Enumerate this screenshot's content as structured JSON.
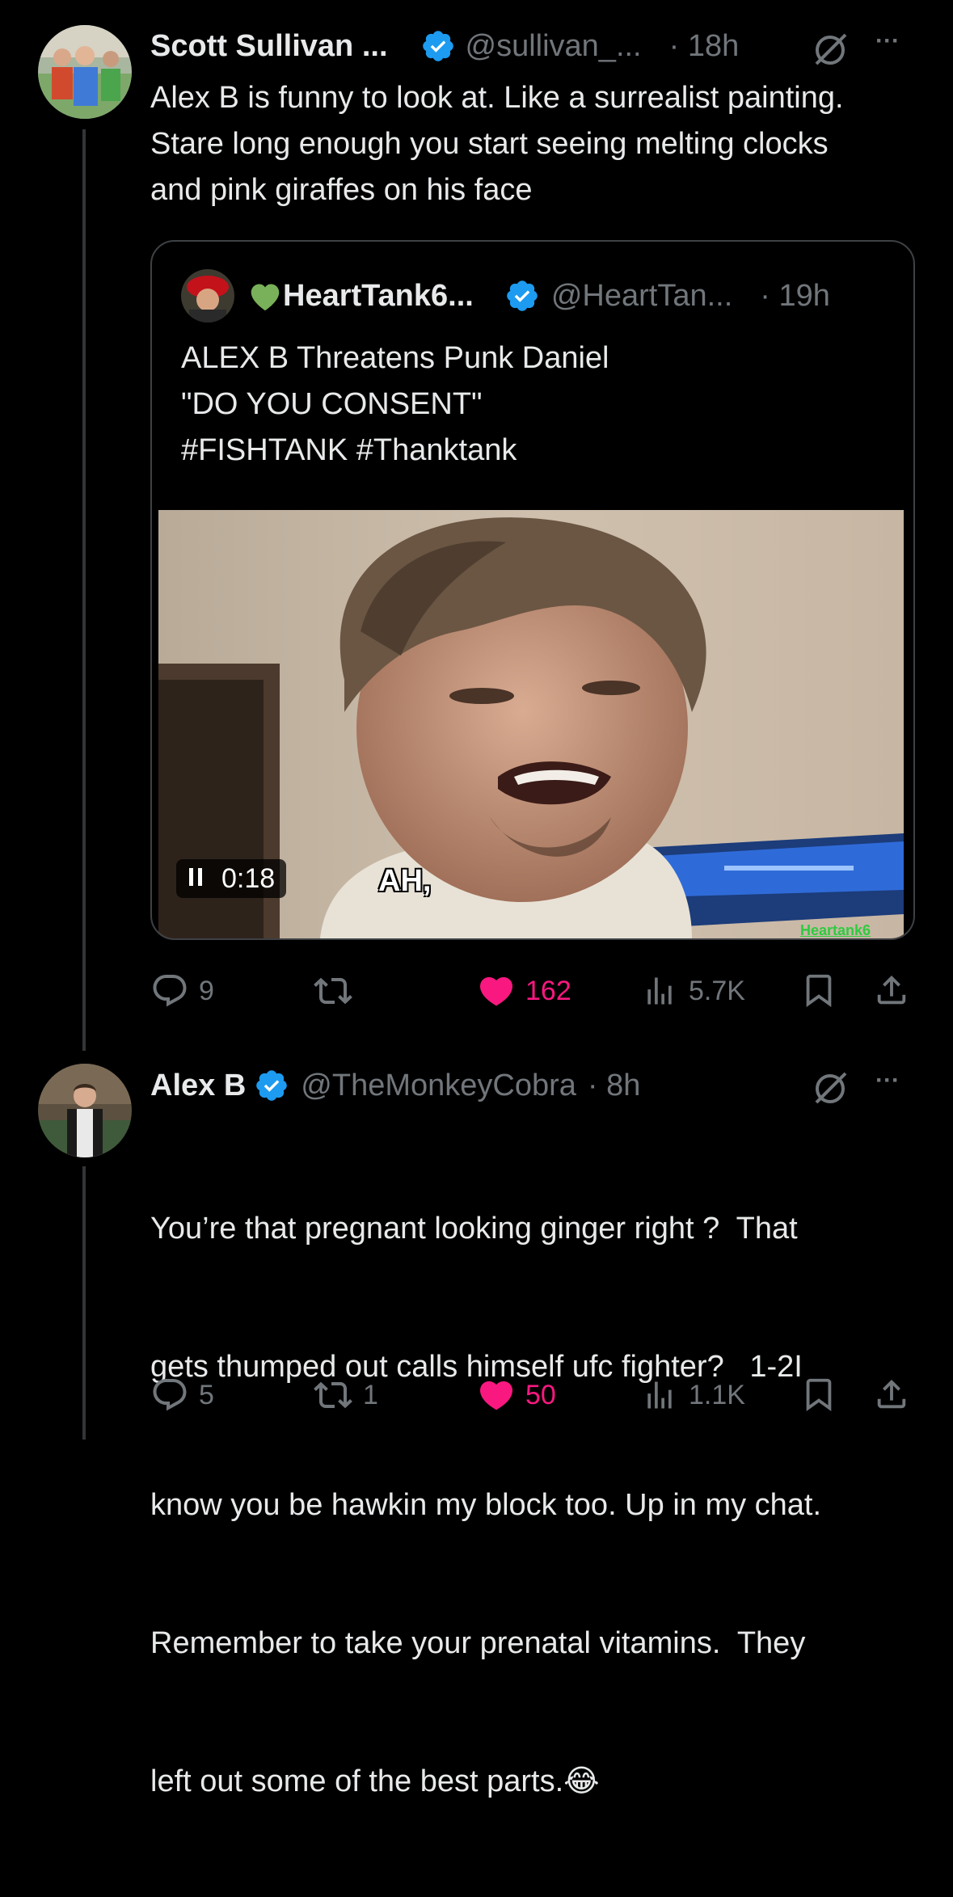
{
  "tweet1": {
    "author_name": "Scott Sullivan ...",
    "handle": "@sullivan_...",
    "time": "· 18h",
    "text": "Alex B is funny to look at. Like a surrealist painting. Stare long enough you start seeing melting clocks and pink giraffes on his face",
    "more_label": "···",
    "quote": {
      "author_name": "HeartTank6...",
      "handle": "@HeartTan...",
      "time": "· 19h",
      "text_lines": [
        "ALEX B Threatens Punk Daniel",
        "\"DO YOU CONSENT\"",
        "#FISHTANK #Thanktank"
      ],
      "video": {
        "timestamp": "0:18",
        "caption": "AH,",
        "watermark": "Heartank6"
      }
    },
    "stats": {
      "replies": "9",
      "reposts": "",
      "likes": "162",
      "views": "5.7K"
    }
  },
  "tweet2": {
    "author_name": "Alex B",
    "handle": "@TheMonkeyCobra",
    "time": "· 8h",
    "text_lines": [
      "You’re that pregnant looking ginger right ?  That",
      "gets thumped out calls himself ufc fighter?   1-2I",
      "know you be hawkin my block too. Up in my chat.",
      "Remember to take your prenatal vitamins.  They",
      "left out some of the best parts.😂"
    ],
    "more_label": "···",
    "stats": {
      "replies": "5",
      "reposts": "1",
      "likes": "50",
      "views": "1.1K"
    }
  },
  "colors": {
    "background": "#000000",
    "text": "#e7e9ea",
    "secondary": "#71767b",
    "like": "#f91880",
    "verified": "#1d9bf0"
  }
}
